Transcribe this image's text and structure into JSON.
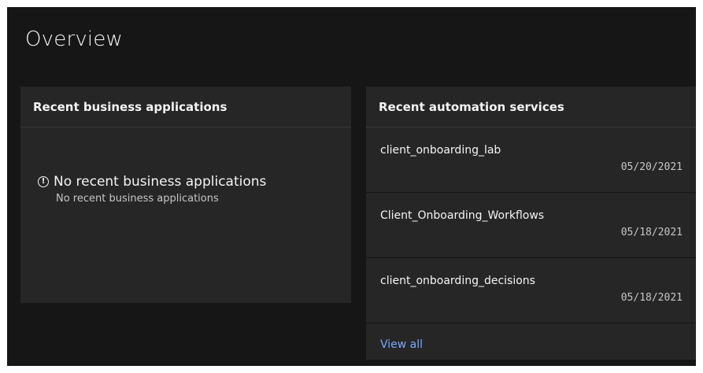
{
  "page": {
    "title": "Overview"
  },
  "business_apps": {
    "header": "Recent business applications",
    "empty_title": "No recent business applications",
    "empty_subtitle": "No recent business applications"
  },
  "automation_services": {
    "header": "Recent automation services",
    "items": [
      {
        "name": "client_onboarding_lab",
        "date": "05/20/2021"
      },
      {
        "name": "Client_Onboarding_Workflows",
        "date": "05/18/2021"
      },
      {
        "name": "client_onboarding_decisions",
        "date": "05/18/2021"
      }
    ],
    "view_all_label": "View all"
  },
  "icons": {
    "info": "info-circle-icon"
  },
  "colors": {
    "background": "#161616",
    "card": "#262626",
    "text_primary": "#f4f4f4",
    "text_secondary": "#c6c6c6",
    "link": "#78a9ff"
  }
}
